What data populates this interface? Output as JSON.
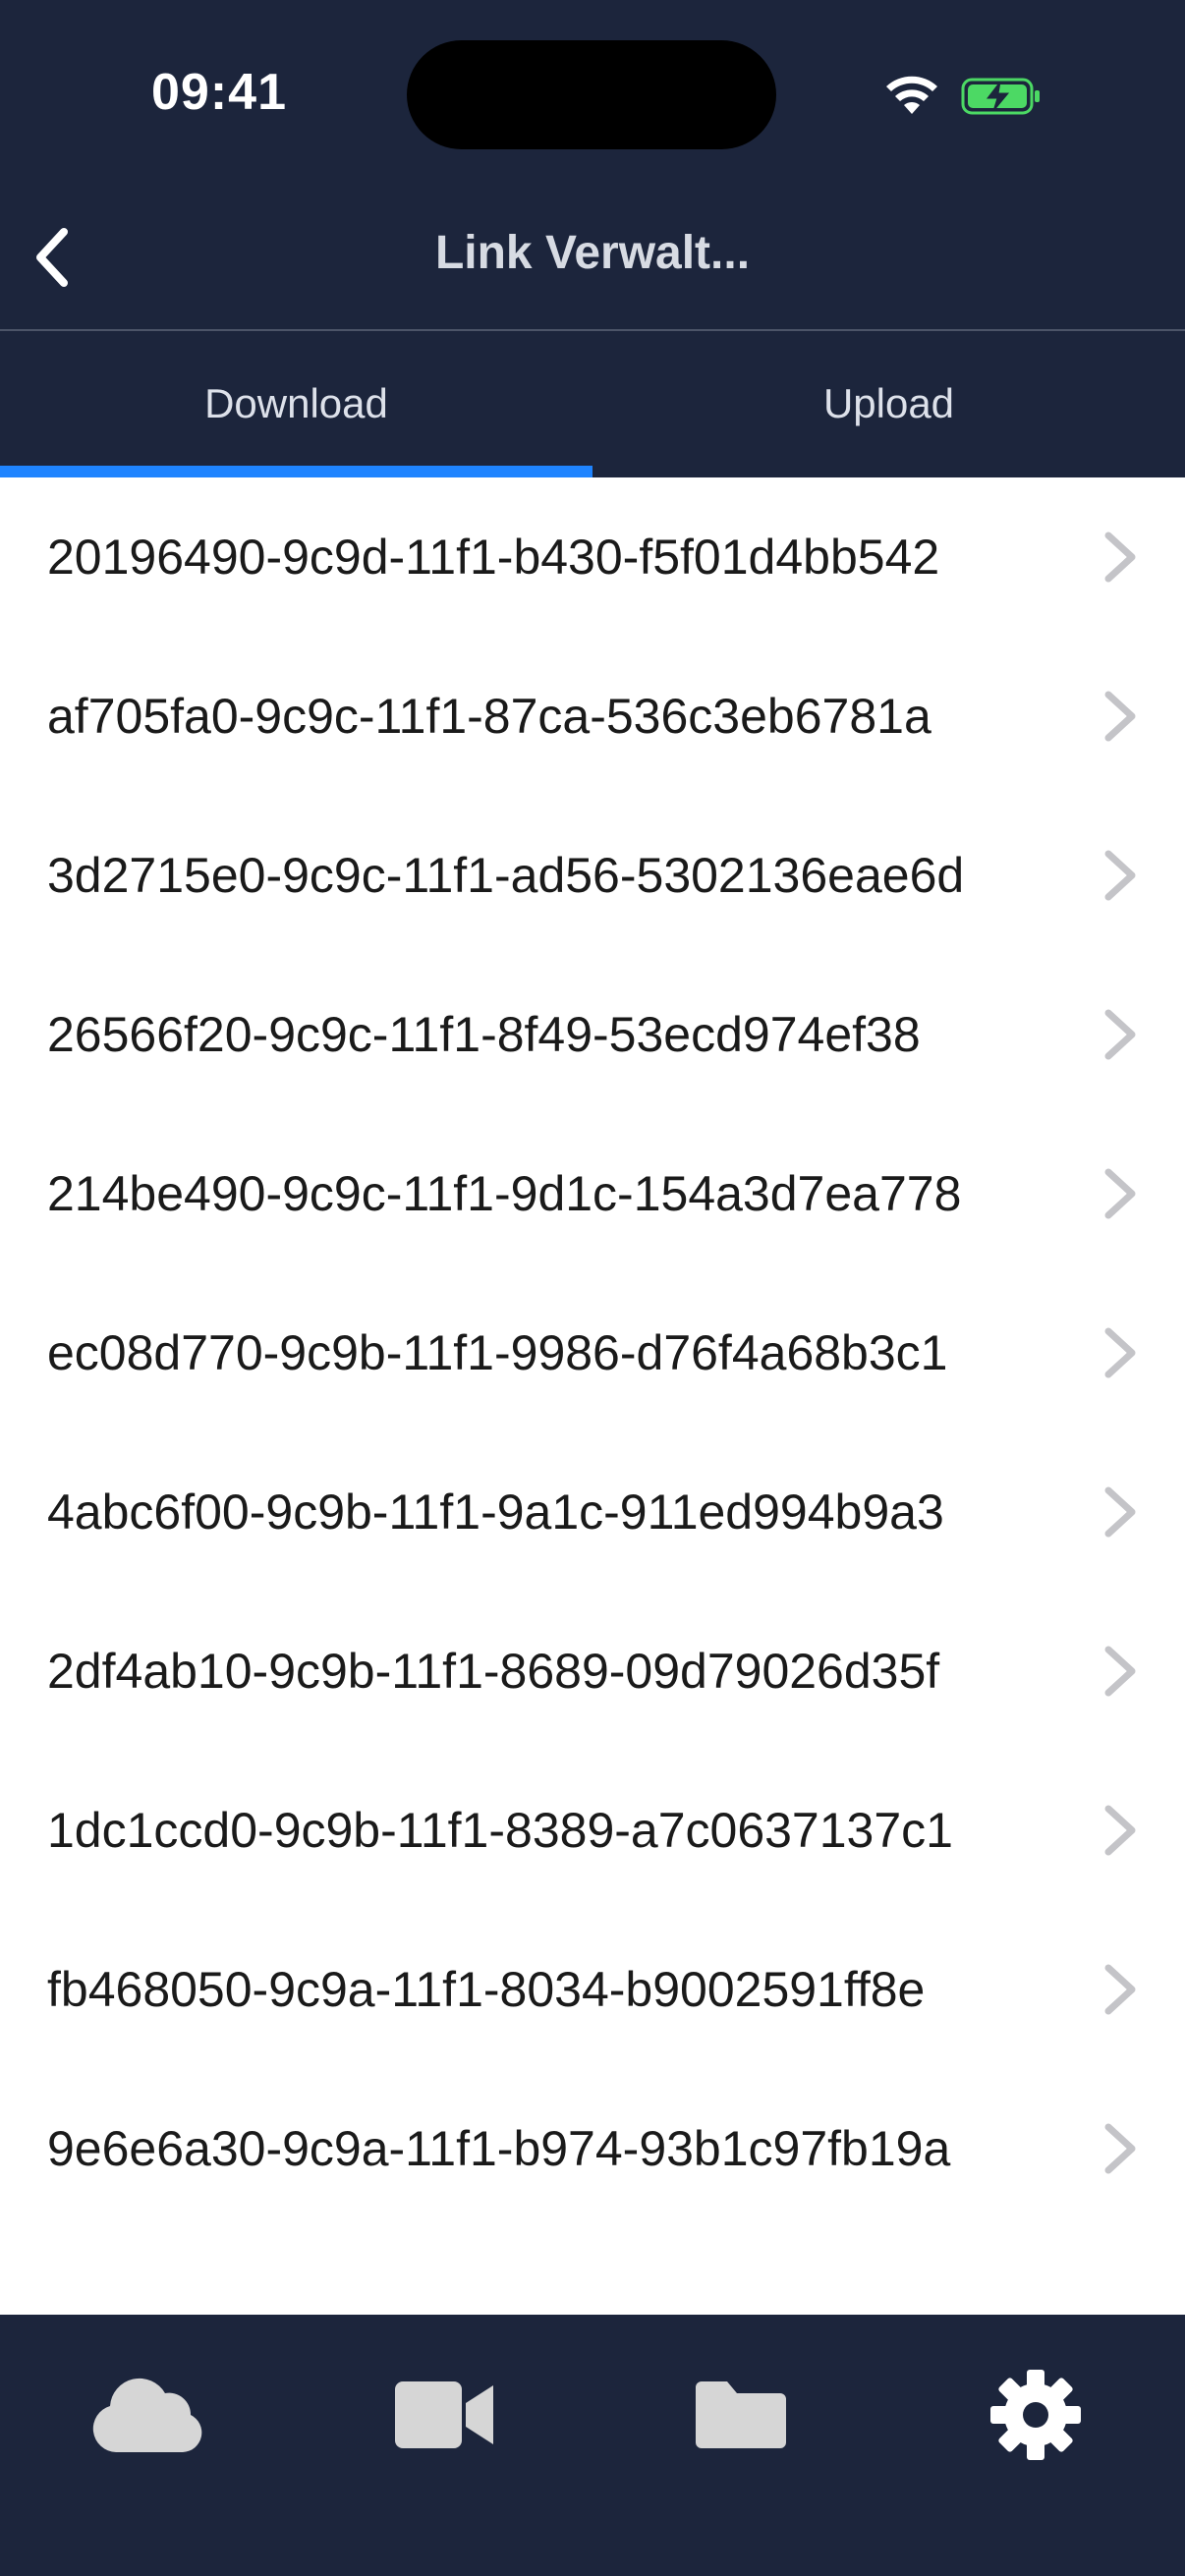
{
  "status_bar": {
    "time": "09:41",
    "icons": [
      "wifi-icon",
      "battery-charging-icon"
    ]
  },
  "header": {
    "title": "Link Verwalt...",
    "back_icon": "chevron-left-icon"
  },
  "tabs": [
    {
      "label": "Download",
      "selected": true
    },
    {
      "label": "Upload",
      "selected": false
    }
  ],
  "links": [
    "20196490-9c9d-11f1-b430-f5f01d4bb542",
    "af705fa0-9c9c-11f1-87ca-536c3eb6781a",
    "3d2715e0-9c9c-11f1-ad56-5302136eae6d",
    "26566f20-9c9c-11f1-8f49-53ecd974ef38",
    "214be490-9c9c-11f1-9d1c-154a3d7ea778",
    "ec08d770-9c9b-11f1-9986-d76f4a68b3c1",
    "4abc6f00-9c9b-11f1-9a1c-911ed994b9a3",
    "2df4ab10-9c9b-11f1-8689-09d79026d35f",
    "1dc1ccd0-9c9b-11f1-8389-a7c0637137c1",
    "fb468050-9c9a-11f1-8034-b9002591ff8e",
    "9e6e6a30-9c9a-11f1-b974-93b1c97fb19a"
  ],
  "tab_bar": {
    "items": [
      {
        "icon": "cloud-icon",
        "active": false
      },
      {
        "icon": "video-camera-icon",
        "active": false
      },
      {
        "icon": "folder-icon",
        "active": false
      },
      {
        "icon": "gear-icon",
        "active": true
      }
    ]
  },
  "colors": {
    "header_bg": "#1c253c",
    "tab_indicator": "#1f84ff",
    "inactive_icon": "#d6d6d6",
    "active_icon": "#ffffff"
  }
}
